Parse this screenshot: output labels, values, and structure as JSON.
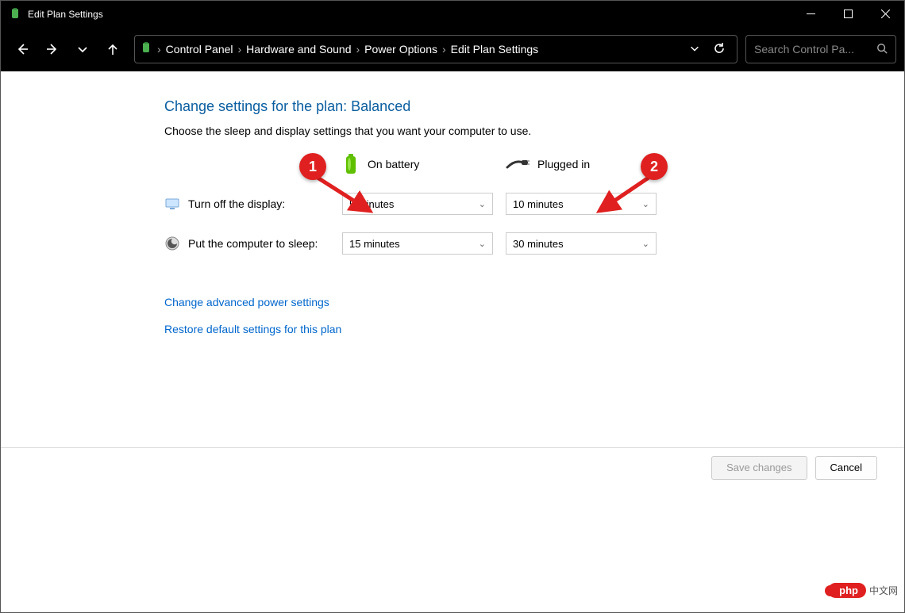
{
  "window": {
    "title": "Edit Plan Settings"
  },
  "breadcrumb": {
    "items": [
      "Control Panel",
      "Hardware and Sound",
      "Power Options",
      "Edit Plan Settings"
    ]
  },
  "search": {
    "placeholder": "Search Control Pa..."
  },
  "page": {
    "heading": "Change settings for the plan: Balanced",
    "subheading": "Choose the sleep and display settings that you want your computer to use.",
    "col_battery": "On battery",
    "col_plugged": "Plugged in",
    "rows": [
      {
        "label": "Turn off the display:",
        "battery": "5 minutes",
        "plugged": "10 minutes"
      },
      {
        "label": "Put the computer to sleep:",
        "battery": "15 minutes",
        "plugged": "30 minutes"
      }
    ],
    "link_advanced": "Change advanced power settings",
    "link_restore": "Restore default settings for this plan",
    "btn_save": "Save changes",
    "btn_cancel": "Cancel"
  },
  "annotations": {
    "marker1": "1",
    "marker2": "2"
  },
  "watermark": {
    "brand": "php",
    "text": "中文网"
  }
}
